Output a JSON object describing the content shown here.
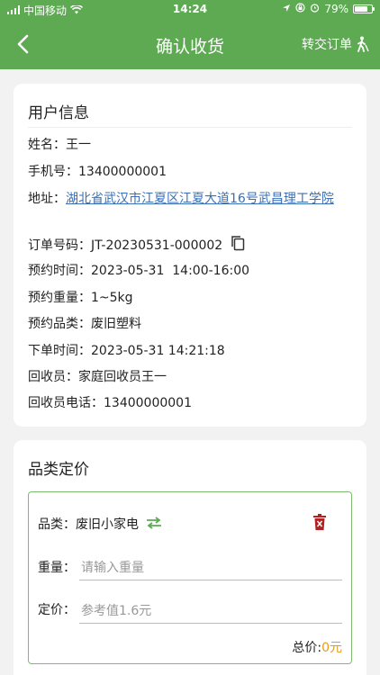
{
  "status_bar": {
    "carrier": "中国移动",
    "time": "14:24",
    "battery": "79%",
    "battery_level": 0.79
  },
  "nav": {
    "title": "确认收货",
    "action_label": "转交订单"
  },
  "user_card": {
    "title": "用户信息",
    "name": {
      "label": "姓名：",
      "value": "王一"
    },
    "phone": {
      "label": "手机号：",
      "value": "13400000001"
    },
    "address": {
      "label": "地址：",
      "value": "湖北省武汉市江夏区江夏大道16号武昌理工学院"
    },
    "order_no": {
      "label": "订单号码：",
      "value": "JT-20230531-000002"
    },
    "appoint_time": {
      "label": "预约时间：",
      "value": "2023-05-31  14:00-16:00"
    },
    "appoint_weight": {
      "label": "预约重量：",
      "value": "1~5kg"
    },
    "appoint_category": {
      "label": "预约品类：",
      "value": "废旧塑料"
    },
    "order_time": {
      "label": "下单时间：",
      "value": "2023-05-31 14:21:18"
    },
    "collector": {
      "label": "回收员：",
      "value": "家庭回收员王一"
    },
    "collector_phone": {
      "label": "回收员电话：",
      "value": "13400000001"
    }
  },
  "pricing_card": {
    "title": "品类定价",
    "item": {
      "category_label": "品类：",
      "category_value": "废旧小家电",
      "weight_label": "重量：",
      "weight_placeholder": "请输入重量",
      "price_label": "定价：",
      "price_placeholder": "参考值1.6元",
      "total_label": "总价:",
      "total_value": "0元"
    }
  },
  "colors": {
    "primary": "#5daa52",
    "link": "#3a6fb8",
    "accent": "#e89b1b",
    "delete": "#b22222"
  }
}
